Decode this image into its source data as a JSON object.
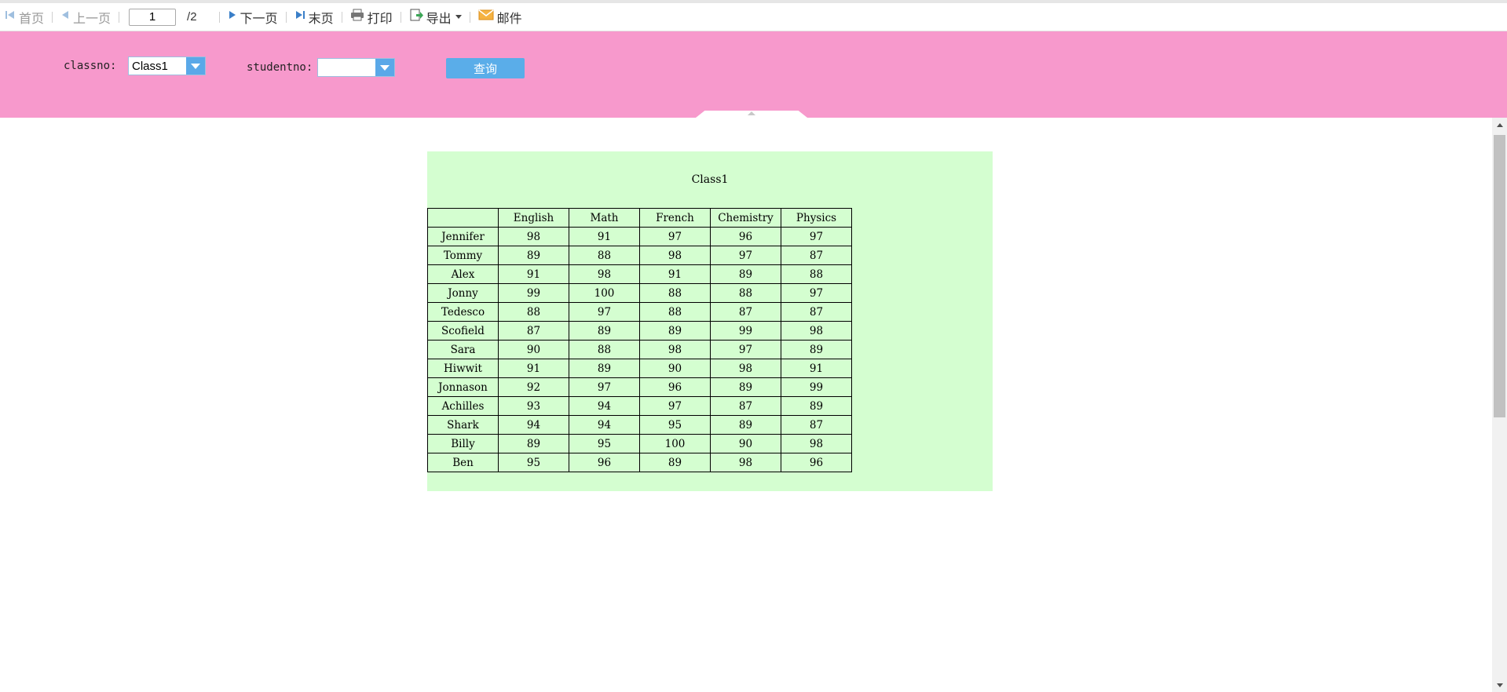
{
  "toolbar": {
    "first_label": "首页",
    "prev_label": "上一页",
    "page_value": "1",
    "page_total": "/2",
    "next_label": "下一页",
    "last_label": "末页",
    "print_label": "打印",
    "export_label": "导出",
    "mail_label": "邮件"
  },
  "params": {
    "classno_label": "classno:",
    "classno_value": "Class1",
    "studentno_label": "studentno:",
    "studentno_value": "",
    "query_label": "查询"
  },
  "report": {
    "title": "Class1",
    "columns": [
      "",
      "English",
      "Math",
      "French",
      "Chemistry",
      "Physics"
    ],
    "rows": [
      [
        "Jennifer",
        "98",
        "91",
        "97",
        "96",
        "97"
      ],
      [
        "Tommy",
        "89",
        "88",
        "98",
        "97",
        "87"
      ],
      [
        "Alex",
        "91",
        "98",
        "91",
        "89",
        "88"
      ],
      [
        "Jonny",
        "99",
        "100",
        "88",
        "88",
        "97"
      ],
      [
        "Tedesco",
        "88",
        "97",
        "88",
        "87",
        "87"
      ],
      [
        "Scofield",
        "87",
        "89",
        "89",
        "99",
        "98"
      ],
      [
        "Sara",
        "90",
        "88",
        "98",
        "97",
        "89"
      ],
      [
        "Hiwwit",
        "91",
        "89",
        "90",
        "98",
        "91"
      ],
      [
        "Jonnason",
        "92",
        "97",
        "96",
        "89",
        "99"
      ],
      [
        "Achilles",
        "93",
        "94",
        "97",
        "87",
        "89"
      ],
      [
        "Shark",
        "94",
        "94",
        "95",
        "89",
        "87"
      ],
      [
        "Billy",
        "89",
        "95",
        "100",
        "90",
        "98"
      ],
      [
        "Ben",
        "95",
        "96",
        "89",
        "98",
        "96"
      ]
    ]
  },
  "colors": {
    "param_panel_bg": "#f799cc",
    "report_bg": "#d4fed0",
    "accent_blue": "#5aade9"
  },
  "icons": [
    "first-page-icon",
    "prev-page-icon",
    "next-page-icon",
    "last-page-icon",
    "printer-icon",
    "export-icon",
    "mail-icon",
    "dropdown-arrow-icon"
  ]
}
